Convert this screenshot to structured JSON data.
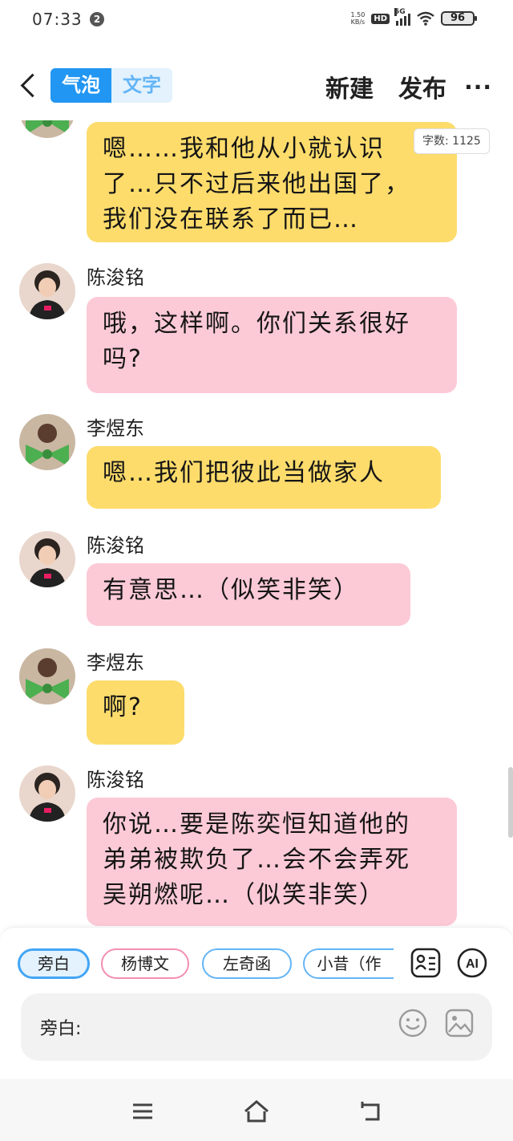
{
  "status_bar": {
    "time": "07:33",
    "notification_count": "2",
    "net_speed_value": "1.50",
    "net_speed_unit": "KB/s",
    "hd": "HD",
    "network": "5G",
    "battery": "96"
  },
  "header": {
    "mode_bubble": "气泡",
    "mode_text": "文字",
    "new_label": "新建",
    "publish_label": "发布",
    "more_label": "···"
  },
  "word_count": {
    "label": "字数:",
    "value": "1125"
  },
  "messages": [
    {
      "sender": "",
      "avatar": "green-bow-avatar",
      "text_lines": [
        "嗯……我和他从小就认识",
        "了…只不过后来他出国了，",
        "我们没在联系了而已…"
      ],
      "color": "yellow"
    },
    {
      "sender": "陈浚铭",
      "avatar": "boy-avatar",
      "text_lines": [
        "哦，这样啊。你们关系很好",
        "吗?"
      ],
      "color": "pink"
    },
    {
      "sender": "李煜东",
      "avatar": "green-bow-avatar",
      "text_lines": [
        "嗯…我们把彼此当做家人"
      ],
      "color": "yellow"
    },
    {
      "sender": "陈浚铭",
      "avatar": "boy-avatar",
      "text_lines": [
        "有意思…（似笑非笑）"
      ],
      "color": "pink"
    },
    {
      "sender": "李煜东",
      "avatar": "green-bow-avatar",
      "text_lines": [
        "啊?"
      ],
      "color": "yellow"
    },
    {
      "sender": "陈浚铭",
      "avatar": "boy-avatar",
      "text_lines": [
        "你说…要是陈奕恒知道他的",
        "弟弟被欺负了…会不会弄死",
        "吴朔燃呢…（似笑非笑）"
      ],
      "color": "pink"
    }
  ],
  "roles": [
    "旁白",
    "杨博文",
    "左奇函",
    "小昔（作"
  ],
  "input": {
    "label": "旁白:"
  },
  "colors": {
    "accent": "#2196f3",
    "bubble_yellow": "#fddc6c",
    "bubble_pink": "#fccad6"
  }
}
